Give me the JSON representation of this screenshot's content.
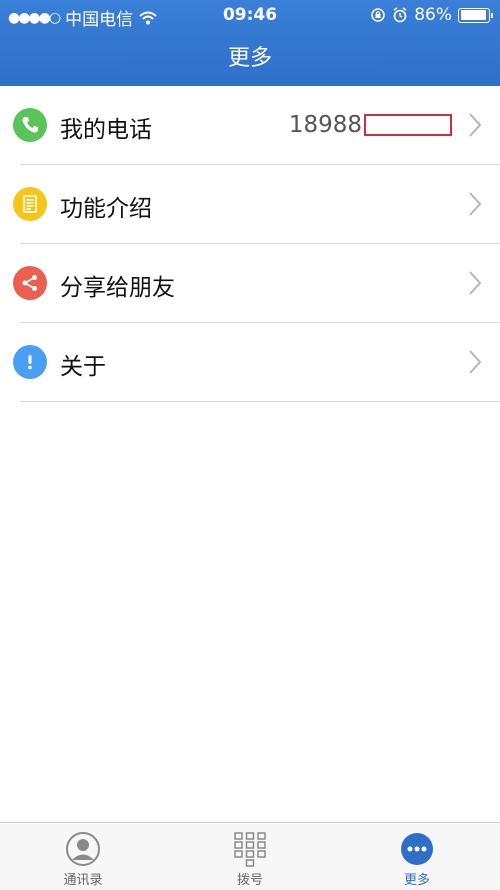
{
  "status_bar": {
    "carrier": "中国电信",
    "time": "09:46",
    "battery": "86%"
  },
  "header": {
    "title": "更多"
  },
  "rows": [
    {
      "label": "我的电话",
      "value": "18988",
      "icon": "phone-icon",
      "color": "#5ac35a"
    },
    {
      "label": "功能介绍",
      "icon": "document-icon",
      "color": "#f5c518"
    },
    {
      "label": "分享给朋友",
      "icon": "share-icon",
      "color": "#ea5f52"
    },
    {
      "label": "关于",
      "icon": "info-icon",
      "color": "#4a9ff5"
    }
  ],
  "tabs": [
    {
      "label": "通讯录",
      "icon": "person-icon"
    },
    {
      "label": "拨号",
      "icon": "dialpad-icon"
    },
    {
      "label": "更多",
      "icon": "more-icon",
      "active": true
    }
  ],
  "colors": {
    "header": "#2f6fc9",
    "accent": "#2f6fc9"
  }
}
